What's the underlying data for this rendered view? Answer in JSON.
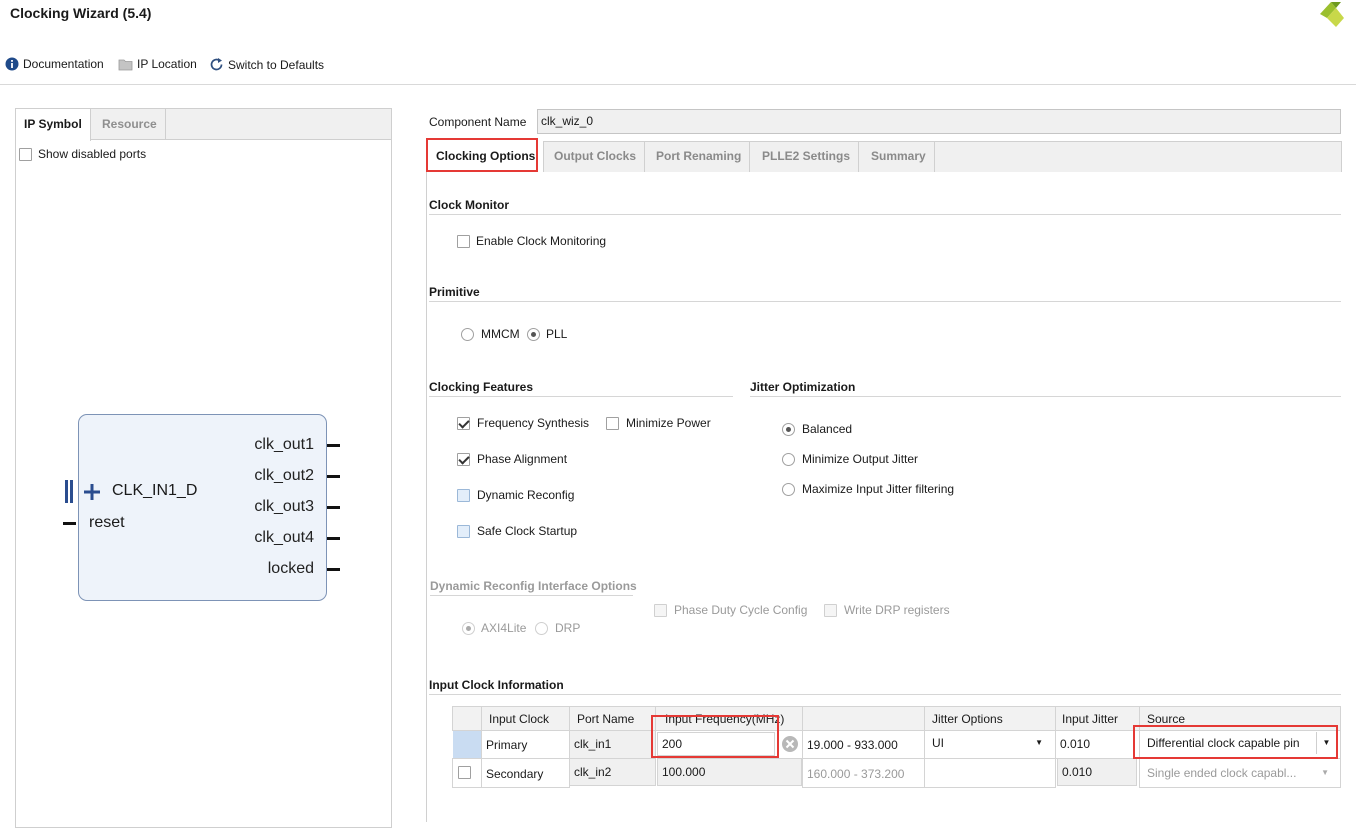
{
  "app": {
    "title": "Clocking Wizard (5.4)"
  },
  "toolbar": {
    "documentation": "Documentation",
    "ip_location": "IP Location",
    "switch_defaults": "Switch to Defaults"
  },
  "left_panel": {
    "tabs": [
      "IP Symbol",
      "Resource"
    ],
    "show_disabled_ports": "Show disabled ports",
    "symbol": {
      "input_port": "CLK_IN1_D",
      "reset_port": "reset",
      "outputs": [
        "clk_out1",
        "clk_out2",
        "clk_out3",
        "clk_out4",
        "locked"
      ]
    }
  },
  "component": {
    "label": "Component Name",
    "value": "clk_wiz_0"
  },
  "tabs": [
    "Clocking Options",
    "Output Clocks",
    "Port Renaming",
    "PLLE2 Settings",
    "Summary"
  ],
  "clock_monitor": {
    "title": "Clock Monitor",
    "enable": "Enable Clock Monitoring"
  },
  "primitive": {
    "title": "Primitive",
    "options": [
      "MMCM",
      "PLL"
    ],
    "selected": "PLL"
  },
  "clocking_features": {
    "title": "Clocking Features",
    "frequency_synthesis": "Frequency Synthesis",
    "minimize_power": "Minimize Power",
    "phase_alignment": "Phase Alignment",
    "dynamic_reconfig": "Dynamic Reconfig",
    "safe_clock_startup": "Safe Clock Startup"
  },
  "jitter_optimization": {
    "title": "Jitter Optimization",
    "options": [
      "Balanced",
      "Minimize Output Jitter",
      "Maximize Input Jitter filtering"
    ],
    "selected": "Balanced"
  },
  "dynamic_reconfig_interface": {
    "title": "Dynamic Reconfig Interface Options",
    "phase_duty": "Phase Duty Cycle Config",
    "write_drp": "Write DRP registers",
    "axi4lite": "AXI4Lite",
    "drp": "DRP"
  },
  "input_clock_info": {
    "title": "Input Clock Information",
    "headers": [
      "Input Clock",
      "Port Name",
      "Input Frequency(MHz)",
      "",
      "Jitter Options",
      "Input Jitter",
      "Source"
    ],
    "primary": {
      "name": "Primary",
      "port": "clk_in1",
      "freq": "200",
      "range": "19.000 - 933.000",
      "jitter_option": "UI",
      "jitter": "0.010",
      "source": "Differential clock capable pin"
    },
    "secondary": {
      "name": "Secondary",
      "port": "clk_in2",
      "freq": "100.000",
      "range": "160.000 - 373.200",
      "jitter": "0.010",
      "source": "Single ended clock capabl..."
    }
  },
  "colors": {
    "highlight_red": "#e53935",
    "symbol_fill": "#eef3fa",
    "symbol_border": "#7d93b6",
    "accent_blue": "#2a4d8f"
  }
}
